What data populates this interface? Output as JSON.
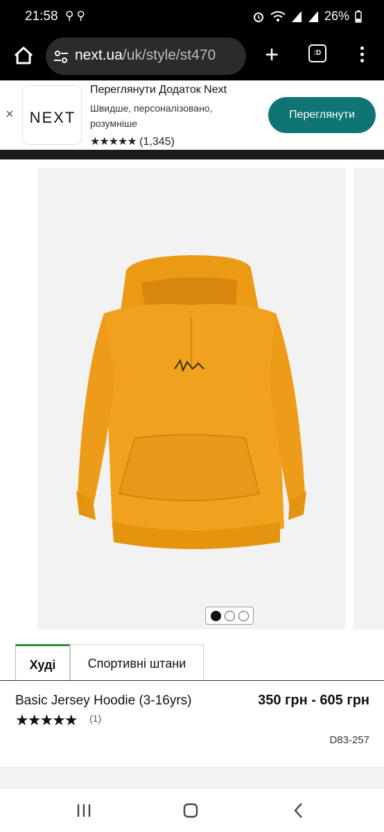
{
  "status_bar": {
    "time": "21:58",
    "battery": "26%"
  },
  "browser": {
    "url_host": "next.ua",
    "url_path": "/uk/style/st470",
    "tabs_label": ":D"
  },
  "app_banner": {
    "title": "Переглянути Додаток Next",
    "subtitle": "Швидше, персоналізовано, розумніше",
    "stars": "★★★★★",
    "rating_count": "(1,345)",
    "cta": "Переглянути",
    "logo_text": "NEXT",
    "close": "×",
    "accent_color": "#0f7474"
  },
  "gallery": {
    "image_count": 3,
    "active_index": 0,
    "product_color": "#f0a21e"
  },
  "tabs": [
    {
      "label": "Худі",
      "active": true
    },
    {
      "label": "Спортивні штани",
      "active": false
    }
  ],
  "product": {
    "name": "Basic Jersey Hoodie (3-16yrs)",
    "stars": "★★★★★",
    "rating_count": "(1)",
    "price": "350 грн - 605 грн",
    "code": "D83-257"
  }
}
